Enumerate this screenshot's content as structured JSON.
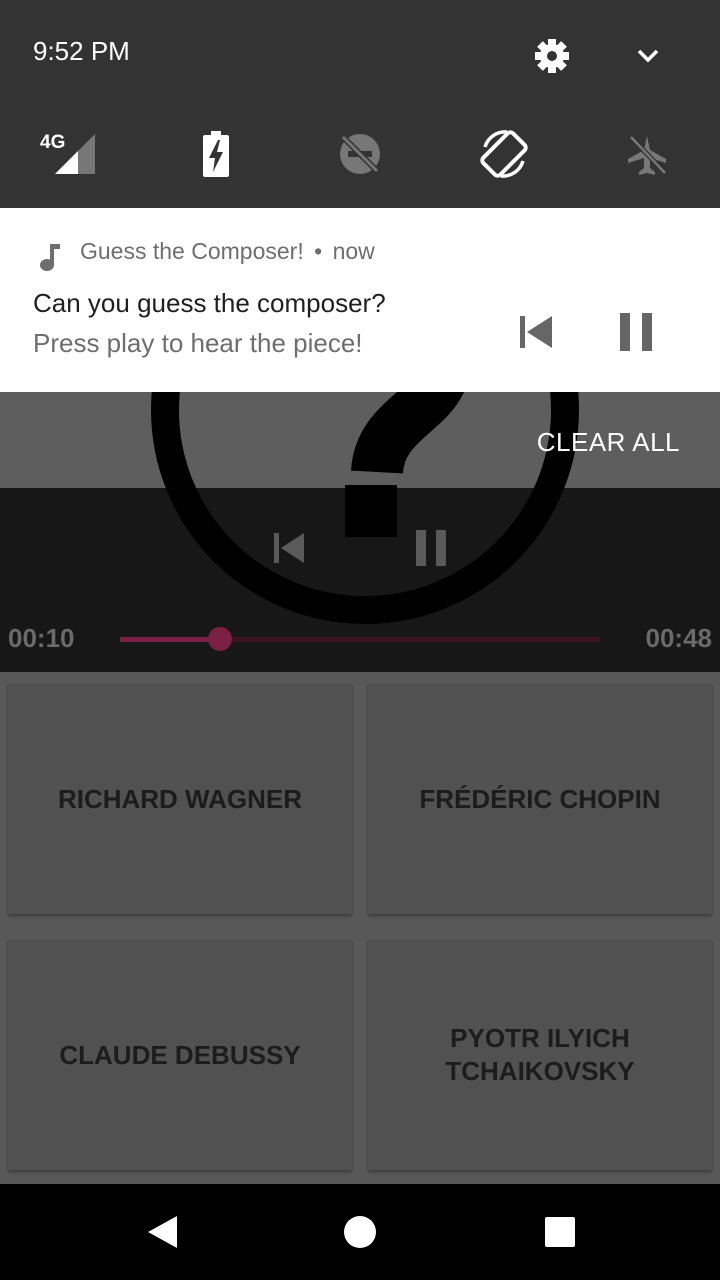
{
  "status_bar": {
    "time": "9:52 PM",
    "network_label": "4G",
    "icons": [
      "settings-icon",
      "expand-chevron-icon"
    ]
  },
  "quick_settings": [
    {
      "name": "mobile-data-tile",
      "icon": "signal-4g-icon"
    },
    {
      "name": "battery-saver-tile",
      "icon": "battery-charging-icon"
    },
    {
      "name": "do-not-disturb-tile",
      "icon": "dnd-off-icon"
    },
    {
      "name": "auto-rotate-tile",
      "icon": "auto-rotate-icon"
    },
    {
      "name": "airplane-mode-tile",
      "icon": "airplane-icon"
    }
  ],
  "notification": {
    "app_name": "Guess the Composer!",
    "separator": "•",
    "time": "now",
    "title": "Can you guess the composer?",
    "text": "Press play to hear the piece!"
  },
  "shade": {
    "clear_all": "CLEAR ALL"
  },
  "player": {
    "elapsed": "00:10",
    "duration": "00:48",
    "progress": 0.208,
    "accent_color": "#7a1f45"
  },
  "answers": [
    "RICHARD WAGNER",
    "FRÉDÉRIC CHOPIN",
    "CLAUDE DEBUSSY",
    "PYOTR ILYICH TCHAIKOVSKY"
  ],
  "colors": {
    "shade": "#333333",
    "notification": "#ffffff",
    "player_bg": "#171717"
  }
}
